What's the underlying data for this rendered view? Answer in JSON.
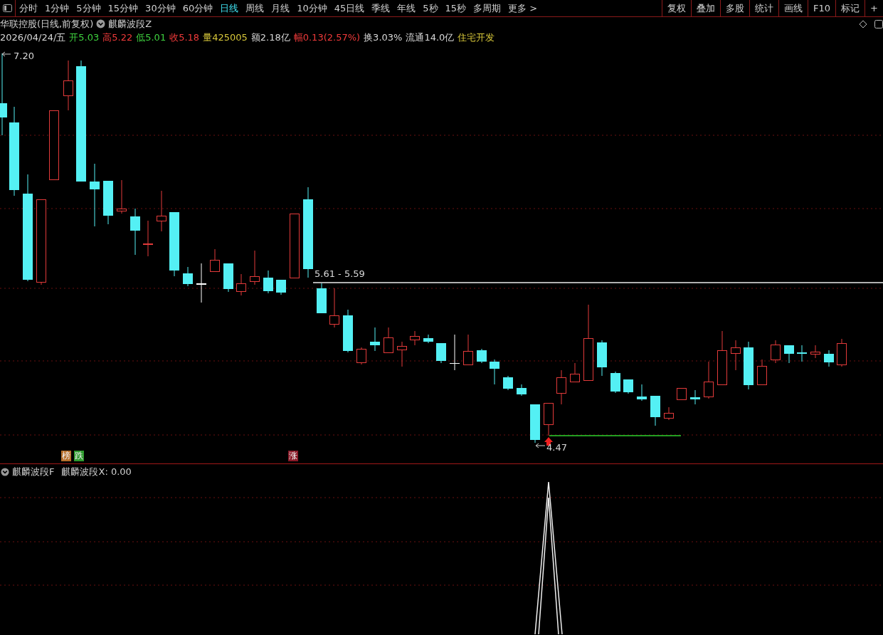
{
  "toolbar": {
    "periods": [
      {
        "label": "分时",
        "selected": false
      },
      {
        "label": "1分钟",
        "selected": false
      },
      {
        "label": "5分钟",
        "selected": false
      },
      {
        "label": "15分钟",
        "selected": false
      },
      {
        "label": "30分钟",
        "selected": false
      },
      {
        "label": "60分钟",
        "selected": false
      },
      {
        "label": "日线",
        "selected": true
      },
      {
        "label": "周线",
        "selected": false
      },
      {
        "label": "月线",
        "selected": false
      },
      {
        "label": "10分钟",
        "selected": false
      },
      {
        "label": "45日线",
        "selected": false
      },
      {
        "label": "季线",
        "selected": false
      },
      {
        "label": "年线",
        "selected": false
      },
      {
        "label": "5秒",
        "selected": false
      },
      {
        "label": "15秒",
        "selected": false
      },
      {
        "label": "多周期",
        "selected": false
      },
      {
        "label": "更多 >",
        "selected": false
      }
    ],
    "tools": [
      "复权",
      "叠加",
      "多股",
      "统计",
      "画线",
      "F10",
      "标记",
      "+"
    ]
  },
  "header": {
    "security": "华联控股(日线,前复权)",
    "indicator": "麒麟波段Z"
  },
  "quote": [
    {
      "text": "2026/04/24/五",
      "color": "#d8d8d8"
    },
    {
      "text": "开5.03",
      "color": "#3fd23f"
    },
    {
      "text": "高5.22",
      "color": "#f03a3a"
    },
    {
      "text": "低5.01",
      "color": "#3fd23f"
    },
    {
      "text": "收5.18",
      "color": "#f03a3a"
    },
    {
      "text": "量425005",
      "color": "#d8c83a"
    },
    {
      "text": "额2.18亿",
      "color": "#d8d8d8"
    },
    {
      "text": "幅0.13(2.57%)",
      "color": "#f03a3a"
    },
    {
      "text": "换3.03%",
      "color": "#d8d8d8"
    },
    {
      "text": "流通14.0亿",
      "color": "#d8d8d8"
    },
    {
      "text": "住宅开发",
      "color": "#d8c83a"
    }
  ],
  "chart_labels": {
    "high": "7.20",
    "low": "4.47",
    "range": "5.61 - 5.59"
  },
  "signals": [
    {
      "text": "榜",
      "color": "#b8702c"
    },
    {
      "text": "跌",
      "color": "#2e9a2e"
    },
    {
      "text": "涨",
      "color": "#8a1a28"
    }
  ],
  "indicator_panel": {
    "name": "麒麟波段F",
    "reading": "麒麟波段X: 0.00"
  }
}
